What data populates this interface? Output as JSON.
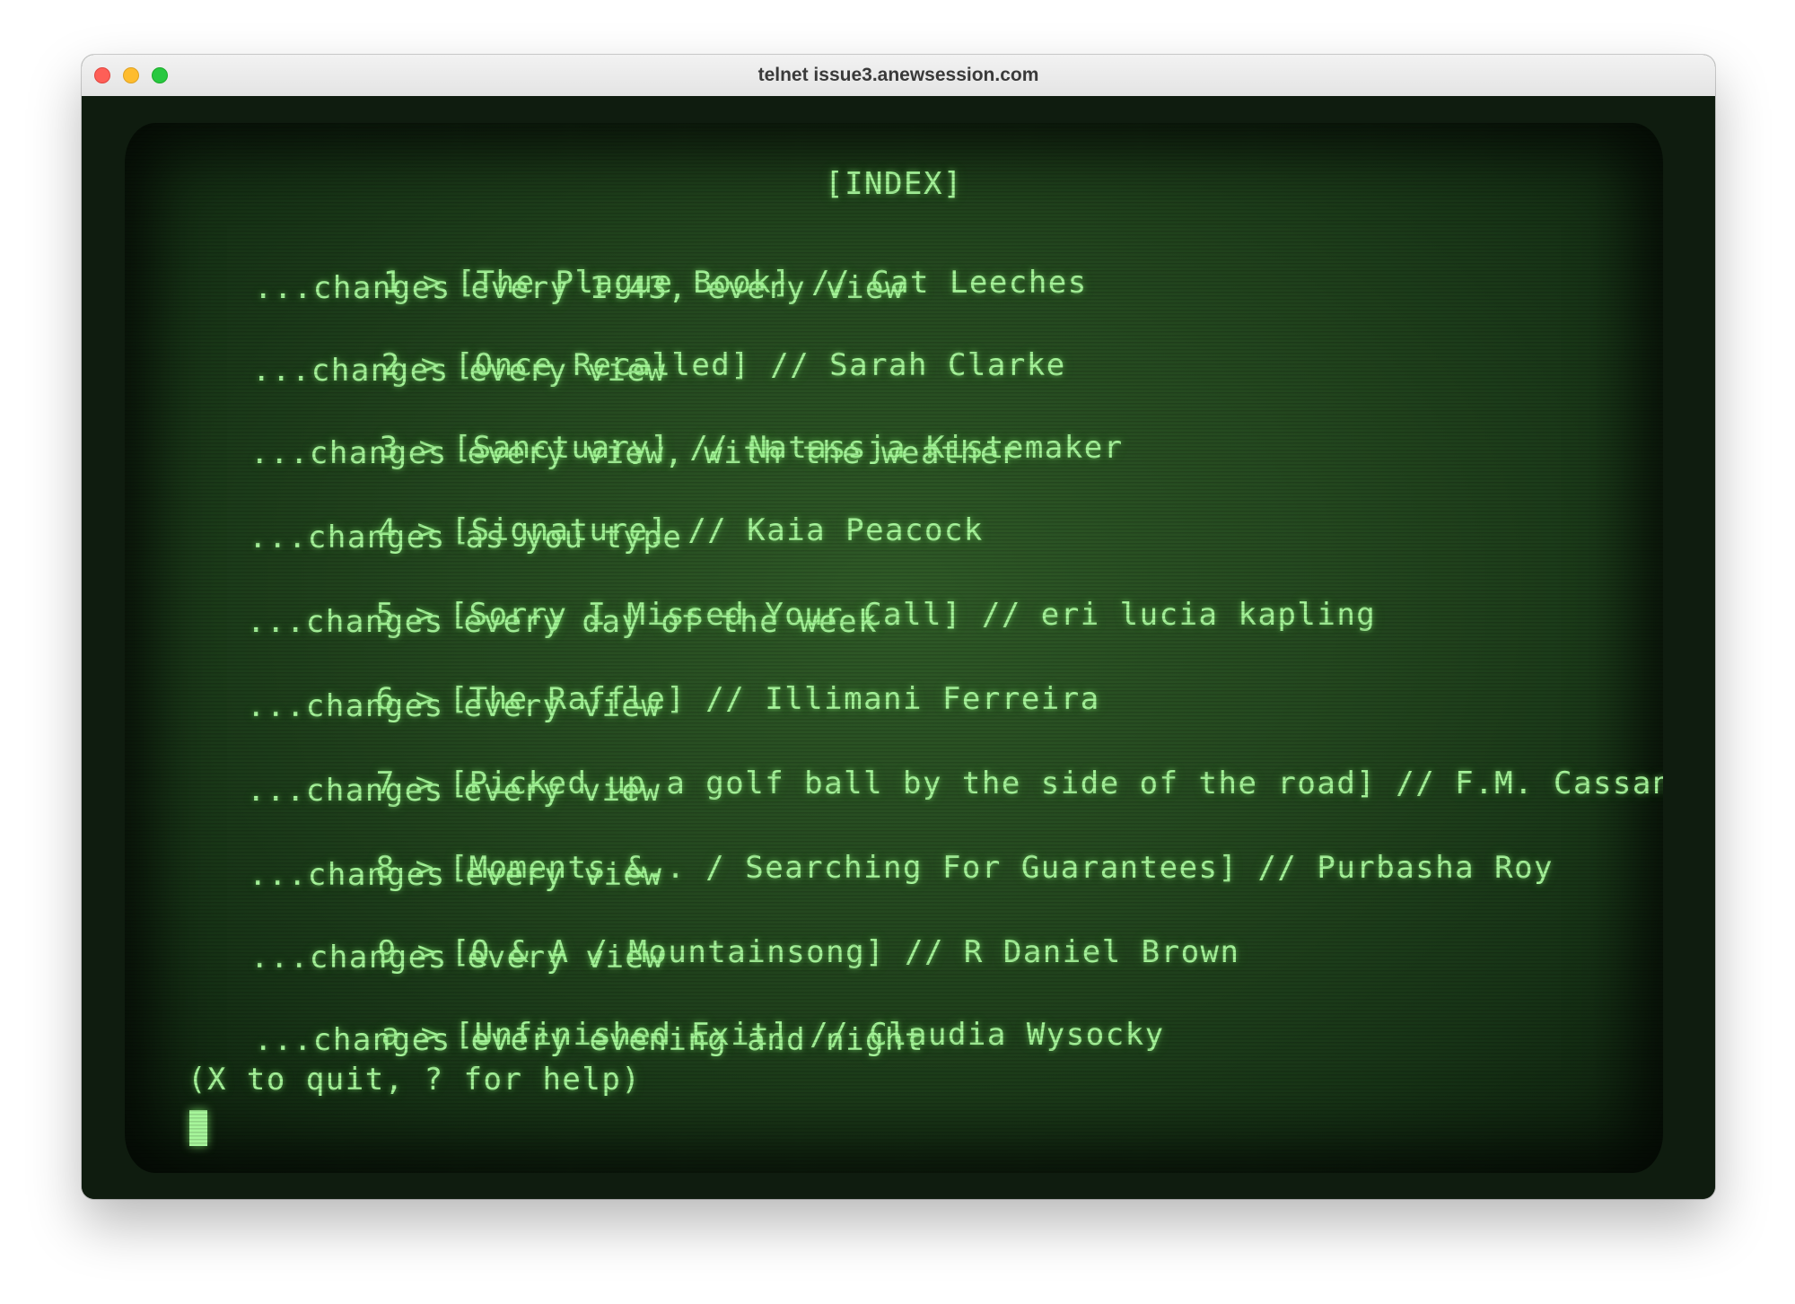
{
  "window": {
    "title": "telnet issue3.anewsession.com"
  },
  "terminal": {
    "heading": "[INDEX]",
    "entries": [
      {
        "key": "1",
        "arrow": ">",
        "title": "[The Plague Book] // Cat Leeches",
        "note": "...changes every 1:43, every view"
      },
      {
        "key": "2",
        "arrow": ">",
        "title": "[Once Recalled] // Sarah Clarke",
        "note": "...changes every view"
      },
      {
        "key": "3",
        "arrow": ">",
        "title": "[Sanctuary] // Natassja Kistemaker",
        "note": "...changes every view, with the weather"
      },
      {
        "key": "4",
        "arrow": ">",
        "title": "[Signature] // Kaia Peacock",
        "note": "...changes as you type"
      },
      {
        "key": "5",
        "arrow": ">",
        "title": "[Sorry I Missed Your Call] // eri lucia kapling",
        "note": "...changes every day of the week"
      },
      {
        "key": "6",
        "arrow": ">",
        "title": "[The Raffle] // Illimani Ferreira",
        "note": "...changes every view"
      },
      {
        "key": "7",
        "arrow": ">",
        "title": "[Picked up a golf ball by the side of the road] // F.M. Cassandra",
        "note": "...changes every view"
      },
      {
        "key": "8",
        "arrow": ">",
        "title": "[Moments &.. / Searching For Guarantees] // Purbasha Roy",
        "note": "...changes every view"
      },
      {
        "key": "9",
        "arrow": ">",
        "title": "[Q & A / Mountainsong] // R Daniel Brown",
        "note": "...changes every view"
      },
      {
        "key": "a",
        "arrow": ">",
        "title": "[Unfinished Exit] // Claudia Wysocky",
        "note": "...changes every evening and night"
      }
    ],
    "footer": "(X to quit, ? for help)"
  },
  "colors": {
    "phosphor": "#a6f59a",
    "screen": "#24481f"
  }
}
